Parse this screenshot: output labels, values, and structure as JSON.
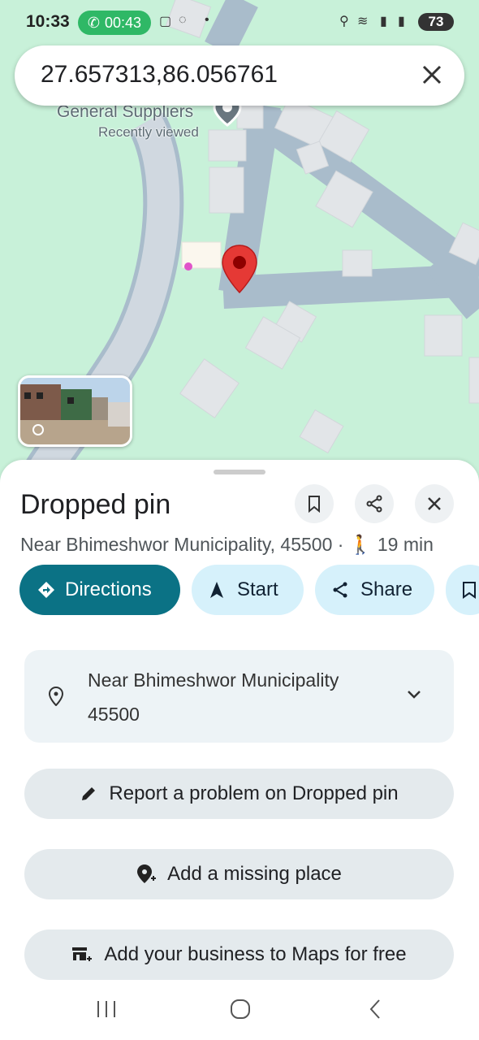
{
  "status_bar": {
    "time": "10:33",
    "call_timer": "00:43",
    "battery": "73"
  },
  "search": {
    "query": "27.657313,86.056761"
  },
  "map": {
    "place_label": "General Suppliers",
    "place_sublabel": "Recently viewed"
  },
  "sheet": {
    "title": "Dropped pin",
    "address_line": "Near Bhimeshwor Municipality, 45500 · ",
    "walk_time": "19 min",
    "actions": {
      "directions": "Directions",
      "start": "Start",
      "share": "Share"
    },
    "address_card": {
      "line1": "Near Bhimeshwor Municipality",
      "line2": "45500"
    },
    "report": "Report a problem on Dropped pin",
    "add_place": "Add a missing place",
    "add_business": "Add your business to Maps for free"
  },
  "colors": {
    "map_bg": "#c8f1d9",
    "road": "#a9bccb",
    "primary": "#0b7285",
    "pin": "#e53935"
  }
}
